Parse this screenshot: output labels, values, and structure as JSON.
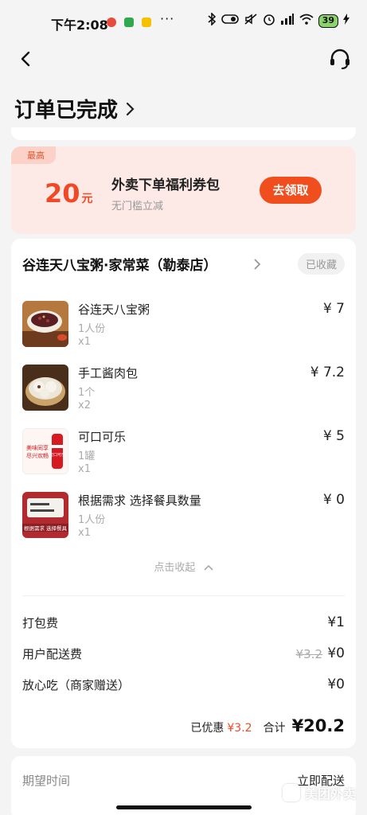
{
  "status_bar": {
    "time": "下午2:08",
    "dots": "···",
    "battery": "39"
  },
  "header": {
    "order_status": "订单已完成"
  },
  "coupon": {
    "tag": "最高",
    "amount": "20",
    "unit": "元",
    "title": "外卖下单福利券包",
    "subtitle": "无门槛立减",
    "button": "去领取"
  },
  "store": {
    "name": "谷连天八宝粥·家常菜（勒泰店）",
    "favorite": "已收藏"
  },
  "items": [
    {
      "name": "谷连天八宝粥",
      "spec": "1人份",
      "qty": "x1",
      "price": "¥ 7"
    },
    {
      "name": "手工酱肉包",
      "spec": "1个",
      "qty": "x2",
      "price": "¥ 7.2"
    },
    {
      "name": "可口可乐",
      "spec": "1罐",
      "qty": "x1",
      "price": "¥ 5"
    },
    {
      "name": "根据需求 选择餐具数量",
      "spec": "1人份",
      "qty": "x1",
      "price": "¥ 0"
    }
  ],
  "thumb_texts": {
    "cola_ad_1": "美味同享",
    "cola_ad_2": "尽兴欢畅",
    "cola_brand": "可口可乐",
    "cutlery_text": "根据需求 选择餐具"
  },
  "collapse": {
    "label": "点击收起"
  },
  "fees": [
    {
      "label": "打包费",
      "value": "¥1"
    },
    {
      "label": "用户配送费",
      "original": "¥3.2",
      "value": "¥0"
    },
    {
      "label": "放心吃（商家赠送）",
      "value": "¥0"
    }
  ],
  "summary": {
    "discount_label": "已优惠",
    "discount_value": "¥3.2",
    "total_label": "合计",
    "total_value": "¥20.2"
  },
  "delivery": {
    "label": "期望时间",
    "value": "立即配送"
  },
  "watermark": "美团外卖",
  "colors": {
    "accent": "#ef4a25",
    "coupon_bg": "#fde9e5",
    "page_bg": "#f4f4f4"
  }
}
